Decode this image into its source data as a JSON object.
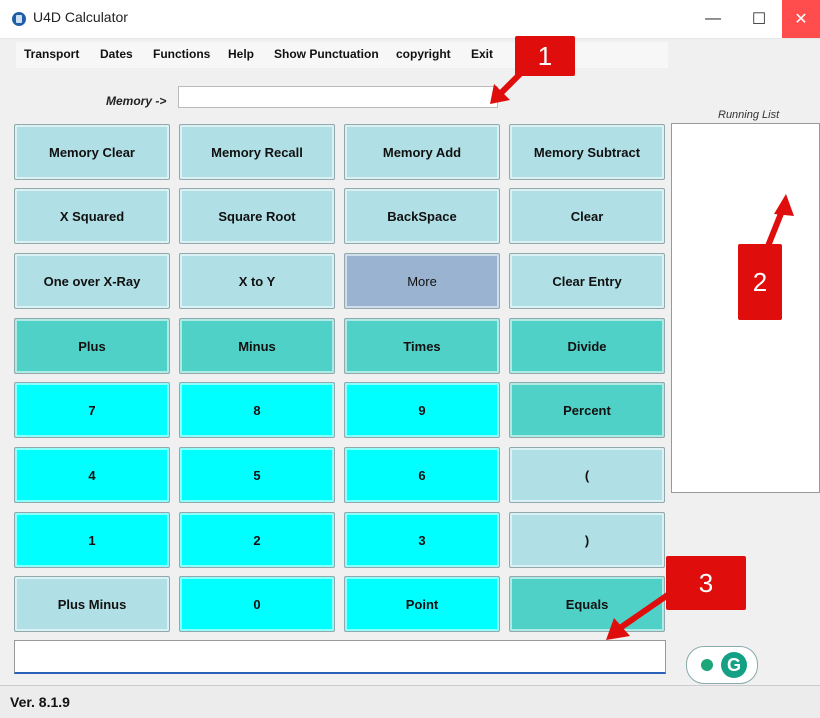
{
  "window": {
    "title": "U4D Calculator"
  },
  "menu": [
    "Transport",
    "Dates",
    "Functions",
    "Help",
    "Show Punctuation",
    "copyright",
    "Exit"
  ],
  "memory": {
    "label": "Memory ->",
    "value": ""
  },
  "running_list": {
    "label": "Running List"
  },
  "keys": [
    [
      "Memory Clear",
      "Memory Recall",
      "Memory Add",
      "Memory Subtract"
    ],
    [
      "X Squared",
      "Square Root",
      "BackSpace",
      "Clear"
    ],
    [
      "One over X-Ray",
      "X to Y",
      "More",
      "Clear Entry"
    ],
    [
      "Plus",
      "Minus",
      "Times",
      "Divide"
    ],
    [
      "7",
      "8",
      "9",
      "Percent"
    ],
    [
      "4",
      "5",
      "6",
      "("
    ],
    [
      "1",
      "2",
      "3",
      ")"
    ],
    [
      "Plus Minus",
      "0",
      "Point",
      "Equals"
    ]
  ],
  "display": {
    "value": ""
  },
  "status": {
    "version": "Ver. 8.1.9"
  },
  "callouts": [
    "1",
    "2",
    "3"
  ],
  "colors": {
    "memory_keys": "#b0dfe5",
    "operator_keys": "#4fd1c8",
    "number_keys": "#00ffff",
    "more_key": "#9ab3d0",
    "callout": "#e00d0d"
  }
}
